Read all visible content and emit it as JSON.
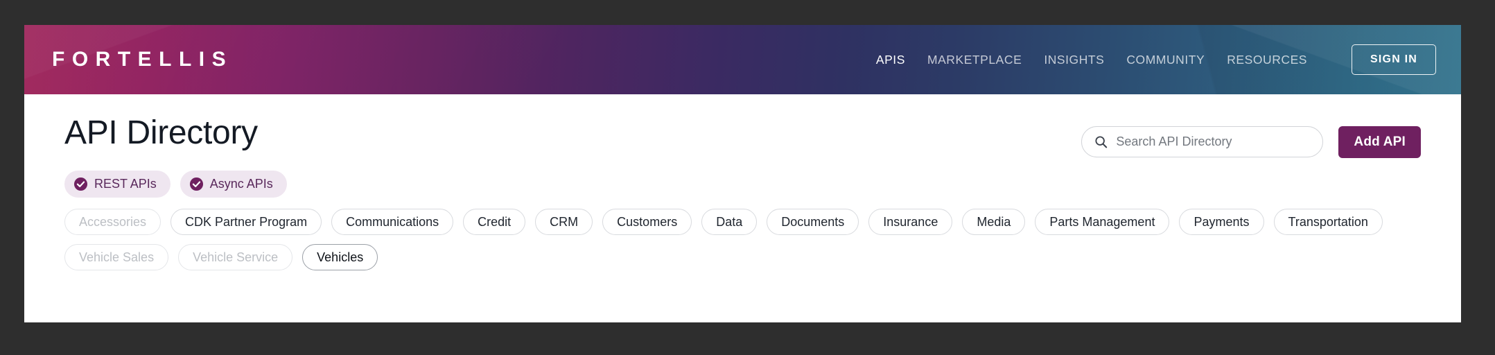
{
  "header": {
    "brand": "FORTELLIS",
    "nav": [
      {
        "label": "APIS",
        "active": true
      },
      {
        "label": "MARKETPLACE",
        "active": false
      },
      {
        "label": "INSIGHTS",
        "active": false
      },
      {
        "label": "COMMUNITY",
        "active": false
      },
      {
        "label": "RESOURCES",
        "active": false
      }
    ],
    "sign_in_label": "SIGN IN",
    "gradient_start": "#9c1f56",
    "gradient_mid": "#3b2a62",
    "gradient_end": "#357a95"
  },
  "main": {
    "page_title": "API Directory",
    "search": {
      "placeholder": "Search API Directory",
      "value": "",
      "icon": "search-icon"
    },
    "add_api_label": "Add API",
    "accent_purple": "#6f2060",
    "type_filters": [
      {
        "label": "REST APIs",
        "selected": true,
        "icon": "check-circle-icon"
      },
      {
        "label": "Async APIs",
        "selected": true,
        "icon": "check-circle-icon"
      }
    ],
    "category_rows": [
      [
        {
          "label": "Accessories",
          "state": "disabled"
        },
        {
          "label": "CDK Partner Program",
          "state": "default"
        },
        {
          "label": "Communications",
          "state": "default"
        },
        {
          "label": "Credit",
          "state": "default"
        },
        {
          "label": "CRM",
          "state": "default"
        },
        {
          "label": "Customers",
          "state": "default"
        },
        {
          "label": "Data",
          "state": "default"
        },
        {
          "label": "Documents",
          "state": "default"
        },
        {
          "label": "Insurance",
          "state": "default"
        },
        {
          "label": "Media",
          "state": "default"
        },
        {
          "label": "Parts Management",
          "state": "default"
        },
        {
          "label": "Payments",
          "state": "default"
        },
        {
          "label": "Transportation",
          "state": "default"
        }
      ],
      [
        {
          "label": "Vehicle Sales",
          "state": "disabled"
        },
        {
          "label": "Vehicle Service",
          "state": "disabled"
        },
        {
          "label": "Vehicles",
          "state": "emphasis"
        }
      ]
    ]
  }
}
